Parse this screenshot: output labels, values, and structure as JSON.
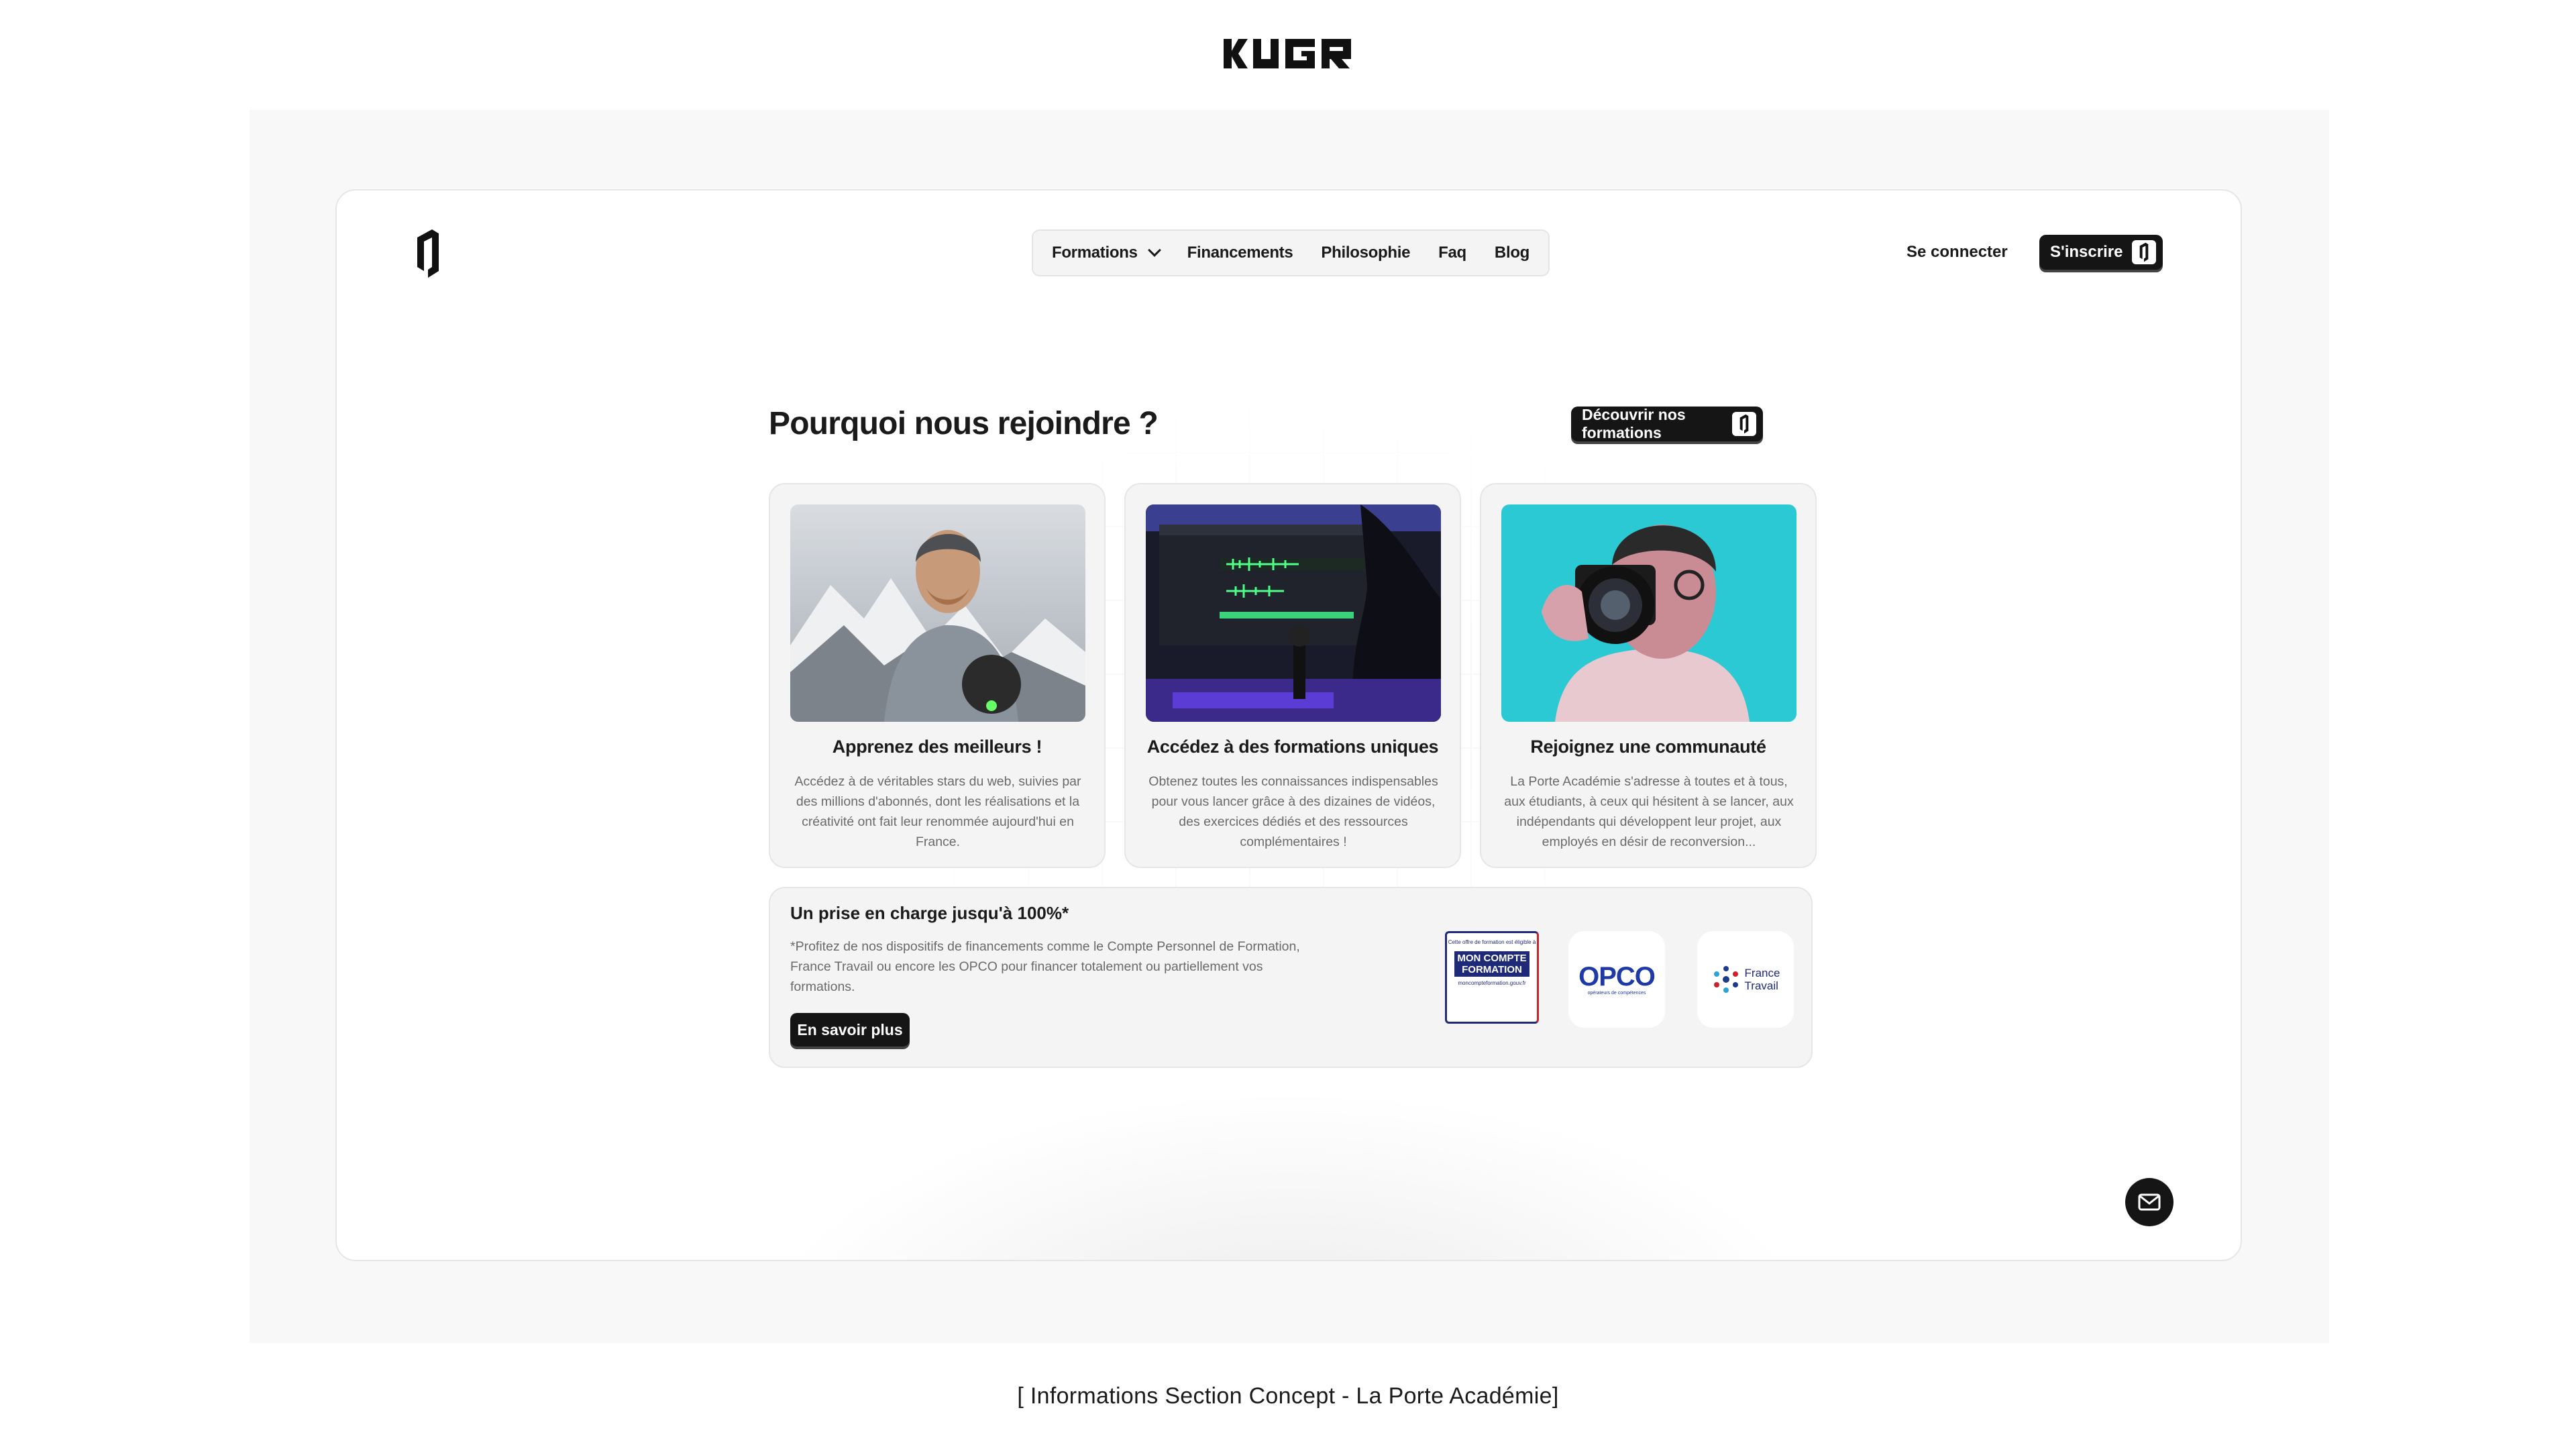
{
  "brand": {
    "wordmark": "HUGO"
  },
  "nav": {
    "items": [
      "Formations",
      "Financements",
      "Philosophie",
      "Faq",
      "Blog"
    ]
  },
  "header": {
    "login": "Se connecter",
    "signup": "S'inscrire"
  },
  "section": {
    "title": "Pourquoi nous rejoindre ?",
    "cta": "Découvrir nos formations"
  },
  "cards": [
    {
      "title": "Apprenez des meilleurs !",
      "text": "Accédez à de véritables stars du web, suivies par des millions d'abonnés, dont les réalisations et la créativité ont fait leur renommée aujourd'hui en France."
    },
    {
      "title": "Accédez à des formations uniques",
      "text": "Obtenez toutes les connaissances indispensables pour vous lancer grâce à des dizaines de vidéos, des exercices dédiés et des ressources complémentaires !"
    },
    {
      "title": "Rejoignez une communauté",
      "text": "La Porte Académie s'adresse à toutes et à tous, aux étudiants, à ceux qui hésitent à se lancer, aux indépendants qui développent leur projet, aux employés en désir de reconversion..."
    }
  ],
  "funding": {
    "title": "Un prise en charge jusqu'à 100%*",
    "text": "*Profitez de nos dispositifs de financements comme le Compte Personnel de Formation, France Travail ou encore les OPCO pour financer totalement ou partiellement vos formations.",
    "button": "En savoir plus",
    "logos": {
      "mcf_top": "Cette offre de formation est éligible à",
      "mcf_main": "MON COMPTE FORMATION",
      "mcf_url": "moncompteformation.gouv.fr",
      "opco": "OPCO",
      "opco_sub": "opérateurs de compétences",
      "ft_line1": "France",
      "ft_line2": "Travail"
    }
  },
  "caption": "[ Informations Section Concept - La Porte Académie]",
  "colors": {
    "dark": "#151515",
    "muted": "#6a6a6a",
    "card": "#f4f4f4"
  }
}
